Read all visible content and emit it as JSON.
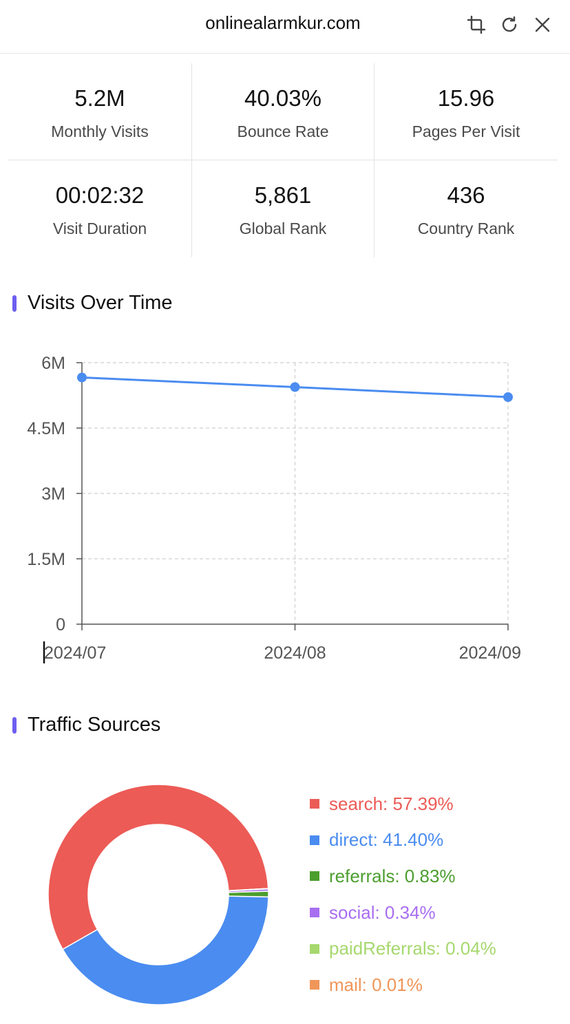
{
  "header": {
    "title": "onlinealarmkur.com",
    "icons": [
      "crop-icon",
      "refresh-icon",
      "close-icon"
    ]
  },
  "stats": [
    {
      "value": "5.2M",
      "label": "Monthly Visits"
    },
    {
      "value": "40.03%",
      "label": "Bounce Rate"
    },
    {
      "value": "15.96",
      "label": "Pages Per Visit"
    },
    {
      "value": "00:02:32",
      "label": "Visit Duration"
    },
    {
      "value": "5,861",
      "label": "Global Rank"
    },
    {
      "value": "436",
      "label": "Country Rank"
    }
  ],
  "sections": {
    "visits_title": "Visits Over Time",
    "traffic_title": "Traffic Sources"
  },
  "colors": {
    "accent_bar": "#6d5ff0",
    "line": "#4a8cf0",
    "grid": "#cfcfcf",
    "axis": "#555555"
  },
  "chart_data": [
    {
      "type": "line",
      "categories": [
        "2024/07",
        "2024/08",
        "2024/09"
      ],
      "series": [
        {
          "values": [
            5.66,
            5.44,
            5.21
          ]
        }
      ],
      "y_unit": "M",
      "ylim": [
        0,
        6
      ],
      "yticks": [
        0,
        1.5,
        3,
        4.5,
        6
      ],
      "ytick_labels": [
        "0",
        "1.5M",
        "3M",
        "4.5M",
        "6M"
      ],
      "grid": true
    },
    {
      "type": "pie",
      "donut": true,
      "legend_position": "right",
      "slices": [
        {
          "name": "search",
          "value": 57.39,
          "label": "search: 57.39%",
          "color": "#ec5b56"
        },
        {
          "name": "direct",
          "value": 41.4,
          "label": "direct: 41.40%",
          "color": "#4a8cf0"
        },
        {
          "name": "referrals",
          "value": 0.83,
          "label": "referrals: 0.83%",
          "color": "#4c9e2f"
        },
        {
          "name": "social",
          "value": 0.34,
          "label": "social: 0.34%",
          "color": "#a86ef0"
        },
        {
          "name": "paidReferrals",
          "value": 0.04,
          "label": "paidReferrals: 0.04%",
          "color": "#a6d86e"
        },
        {
          "name": "mail",
          "value": 0.01,
          "label": "mail: 0.01%",
          "color": "#f0965a"
        }
      ]
    }
  ]
}
